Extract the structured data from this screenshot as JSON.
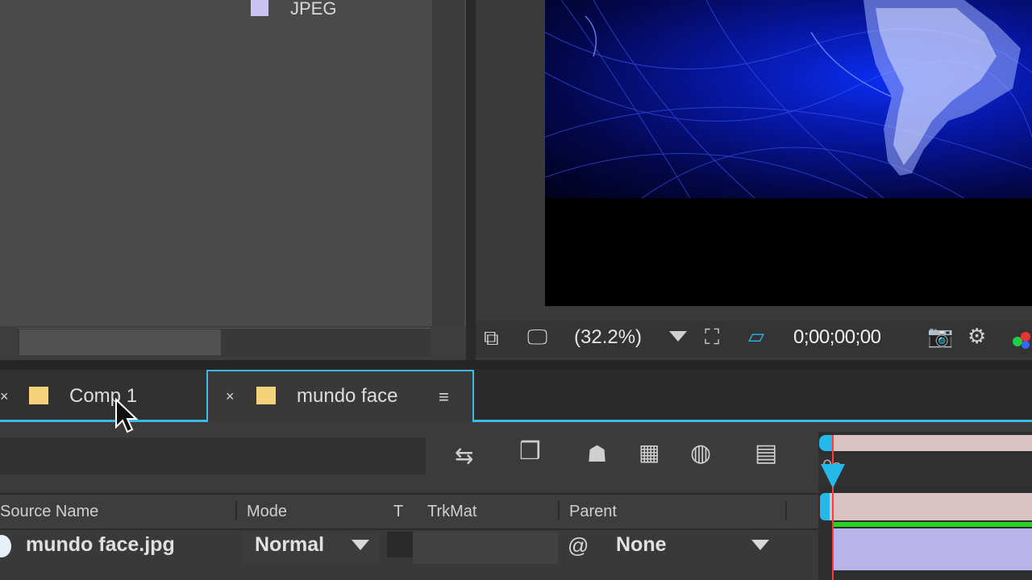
{
  "project_panel": {
    "item_type": "JPEG",
    "item_swatch_color": "#c9c4ef"
  },
  "viewer": {
    "zoom": "(32.2%)",
    "timecode": "0;00;00;00",
    "toolbar_icons": [
      "always-preview-icon",
      "display-icon",
      "zoom-dropdown-icon",
      "region-of-interest-icon",
      "transparency-grid-icon",
      "snapshot-icon",
      "show-snapshot-icon",
      "channel-icon"
    ]
  },
  "timeline": {
    "tabs": [
      {
        "label": "Comp 1",
        "close": "×",
        "swatch_color": "#f6d27a"
      },
      {
        "label": "mundo face",
        "close": "×",
        "swatch_color": "#f6d27a",
        "menu": "≡",
        "active": true
      }
    ],
    "tool_icons": [
      "comp-flowchart-icon",
      "draft-3d-icon",
      "shy-layers-icon",
      "frame-blending-icon",
      "motion-blur-icon",
      "graph-editor-icon"
    ],
    "columns": {
      "source_name": "Source Name",
      "mode": "Mode",
      "t": "T",
      "trkmat": "TrkMat",
      "parent": "Parent"
    },
    "layer": {
      "name": "mundo face.jpg",
      "mode": "Normal",
      "parent": "None"
    },
    "ruler_label": "0s",
    "accent_color": "#3cb9e6",
    "cti_color": "#ff3a3a"
  }
}
